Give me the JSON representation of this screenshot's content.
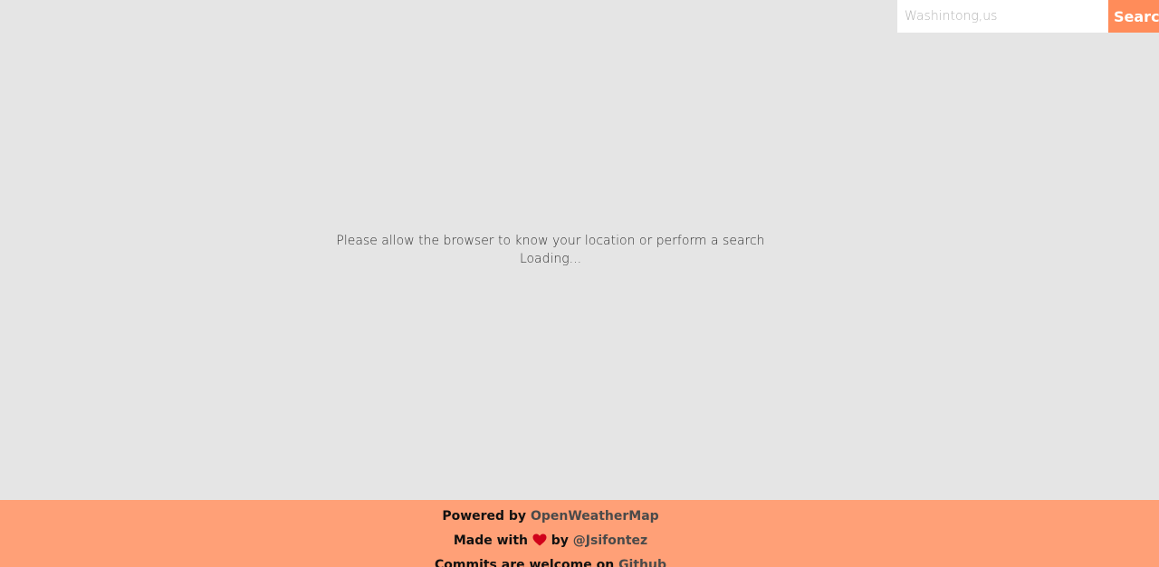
{
  "search": {
    "placeholder": "Washintong,us",
    "button_label": "Search"
  },
  "message": {
    "prompt": "Please allow the browser to know your location or perform a search",
    "status": "Loading..."
  },
  "footer": {
    "powered_prefix": "Powered by",
    "powered_link": "OpenWeatherMap",
    "made_prefix": "Made with",
    "made_by": "by",
    "author_link": "@Jsifontez",
    "commits_prefix": "Commits are welcome on",
    "github_link": "Github"
  },
  "icons": {
    "heart": "heart-icon"
  },
  "colors": {
    "background": "#e5e5e5",
    "accent": "#ff8c5a",
    "footer": "#ffa077",
    "heart": "#d0021b"
  }
}
